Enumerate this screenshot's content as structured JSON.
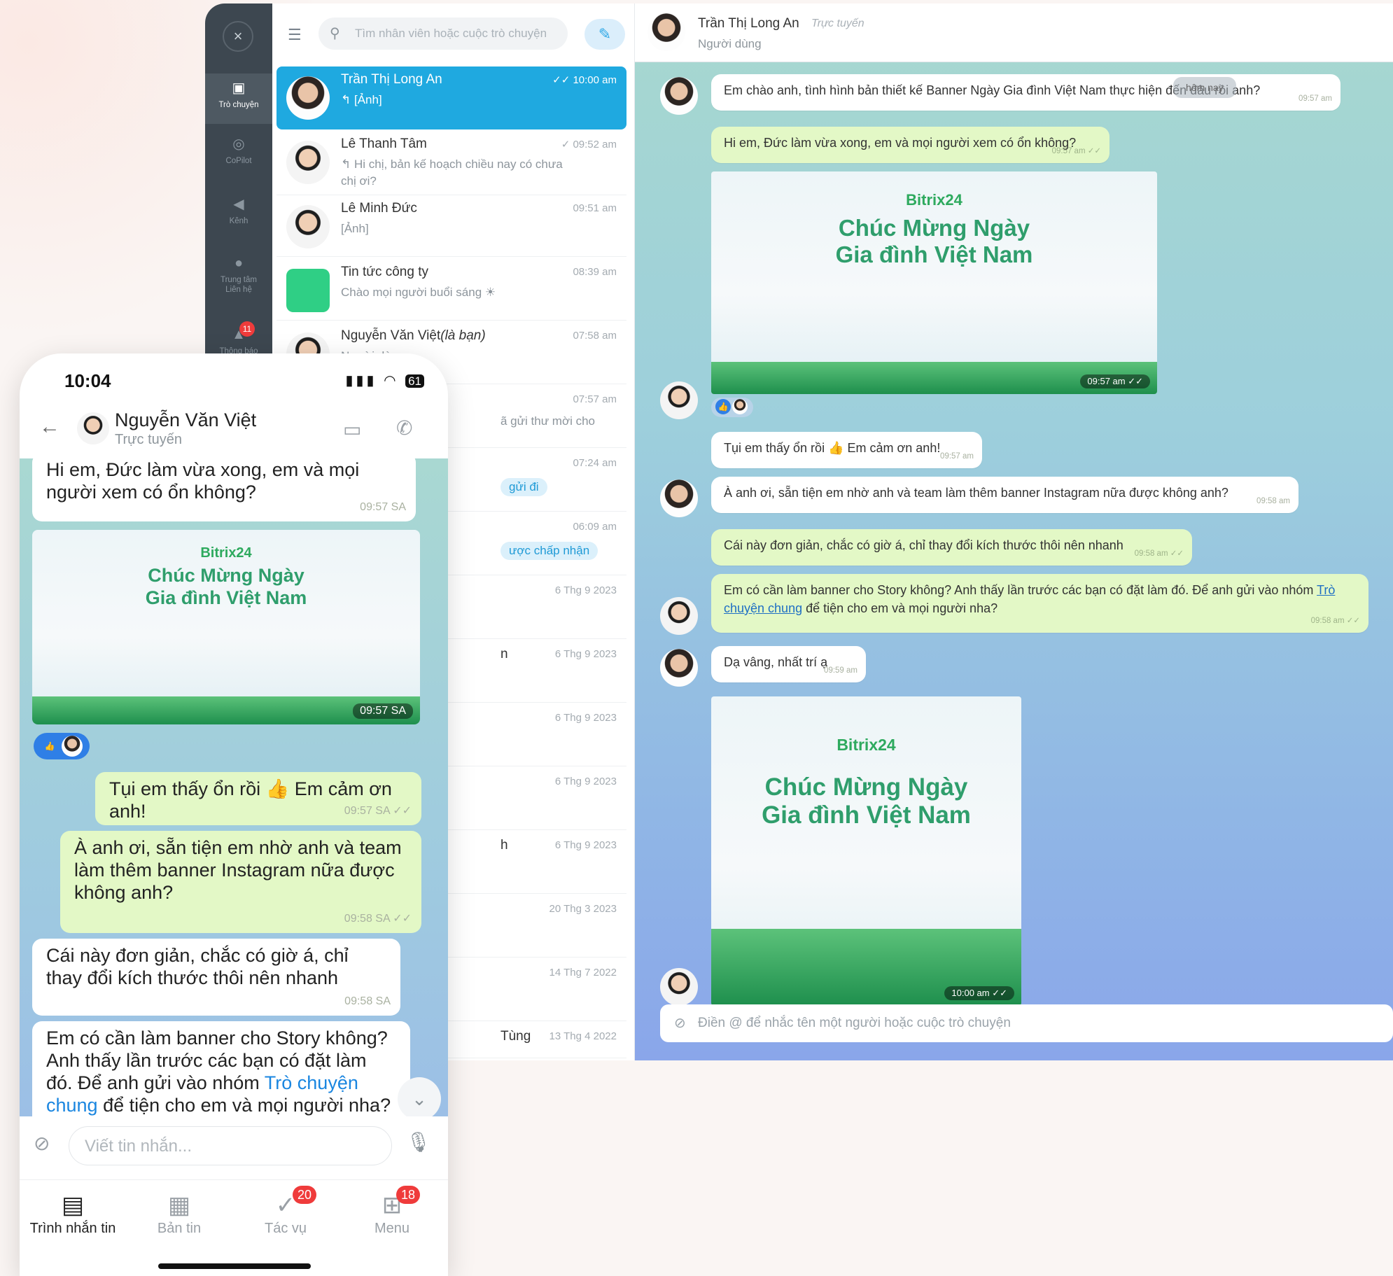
{
  "desktop": {
    "rail": {
      "close": "×",
      "items": [
        {
          "label": "Trò chuyện"
        },
        {
          "label": "CoPilot"
        },
        {
          "label": "Kênh"
        },
        {
          "label": "Trung tâm Liên hệ"
        },
        {
          "label": "Thông báo"
        }
      ],
      "notif_badge": "11"
    },
    "chatlist": {
      "search_placeholder": "Tìm nhân viên hoặc cuộc trò chuyện",
      "items": [
        {
          "name": "Trần Thị Long An",
          "preview": "↰ [Ảnh]",
          "time": "✓✓ 10:00 am"
        },
        {
          "name": "Lê Thanh Tâm",
          "preview": "↰ Hi chị, bản kế hoạch chiều nay có chưa chị ơi?",
          "time": "✓ 09:52 am"
        },
        {
          "name": "Lê Minh Đức",
          "preview": "[Ảnh]",
          "time": "09:51 am"
        },
        {
          "name": "Tin tức công ty",
          "preview": "Chào mọi người buổi sáng ☀",
          "time": "08:39 am"
        },
        {
          "name": "Nguyễn Văn Việt",
          "name_suffix": "(là bạn)",
          "preview": "Người dùng",
          "time": "07:58 am"
        },
        {
          "name": "",
          "preview": "ã gửi thư mời cho",
          "time": "07:57 am"
        },
        {
          "name": "",
          "preview": "",
          "time": "07:24 am",
          "pill": "gửi đi"
        },
        {
          "name": "",
          "preview": "",
          "time": "06:09 am",
          "pill": "ược chấp nhận"
        },
        {
          "name": "",
          "preview": "",
          "time": "6 Thg 9 2023"
        },
        {
          "name": "n",
          "preview": "",
          "time": "6 Thg 9 2023"
        },
        {
          "name": "",
          "preview": "",
          "time": "6 Thg 9 2023"
        },
        {
          "name": "",
          "preview": "",
          "time": "6 Thg 9 2023"
        },
        {
          "name": "h",
          "preview": "",
          "time": "6 Thg 9 2023"
        },
        {
          "name": "",
          "preview": "",
          "time": "20 Thg 3 2023"
        },
        {
          "name": "",
          "preview": "",
          "time": "14 Thg 7 2022"
        },
        {
          "name": "Tùng",
          "preview": "",
          "time": "13 Thg 4 2022"
        }
      ]
    },
    "conversation": {
      "name": "Trần Thị Long An",
      "status": "Trực tuyến",
      "role": "Người dùng",
      "date_divider": "hôm nay",
      "messages": [
        {
          "text": "Em chào anh, tình hình bản thiết kế Banner Ngày Gia đình Việt Nam thực hiện đến đâu rồi anh?",
          "time": "09:57 am"
        },
        {
          "text": "Hi em, Đức làm vừa xong, em và mọi người xem có ổn không?",
          "time": "09:57 am ✓✓"
        },
        {
          "text": "Tụi em thấy ổn rồi 👍 Em cảm ơn anh!",
          "time": "09:57 am"
        },
        {
          "text": "À anh ơi, sẵn tiện em nhờ anh và team làm thêm banner Instagram nữa được không anh?",
          "time": "09:58 am"
        },
        {
          "text": "Cái này đơn giản, chắc có giờ á, chỉ thay đổi kích thước thôi nên nhanh",
          "time": "09:58 am ✓✓"
        },
        {
          "text_a": "Em có cần làm banner cho Story không? Anh thấy lần trước các bạn có đặt làm đó. Để anh gửi vào nhóm ",
          "link": "Trò chuyện chung",
          "text_b": " để tiện cho em và mọi người nha?",
          "time": "09:58 am ✓✓"
        },
        {
          "text": "Dạ vâng, nhất trí ạ",
          "time": "09:59 am"
        }
      ],
      "banner1": {
        "brand": "Bitrix24",
        "line1": "Chúc Mừng Ngày",
        "line2": "Gia đình Việt Nam",
        "time": "09:57 am ✓✓"
      },
      "banner2": {
        "brand": "Bitrix24",
        "line1": "Chúc Mừng Ngày",
        "line2": "Gia đình Việt Nam",
        "time": "10:00 am ✓✓"
      },
      "input_placeholder": "Điền @ để nhắc tên một người hoặc cuộc trò chuyện"
    }
  },
  "phone": {
    "status_time": "10:04",
    "battery": "61",
    "contact_name": "Nguyễn Văn Việt",
    "contact_status": "Trực tuyến",
    "messages": [
      {
        "text": "Hi em, Đức làm vừa xong, em và mọi người xem có ổn không?",
        "time": "09:57 SA"
      },
      {
        "text": "Tụi em thấy ổn rồi 👍 Em cảm ơn anh!",
        "time": "09:57 SA ✓✓"
      },
      {
        "text": "À anh ơi, sẵn tiện em nhờ anh và team làm thêm banner Instagram nữa được không anh?",
        "time": "09:58 SA ✓✓"
      },
      {
        "text": "Cái này đơn giản, chắc có giờ á, chỉ thay đổi kích thước thôi nên nhanh",
        "time": "09:58 SA"
      },
      {
        "text_a": "Em có cần làm banner cho Story không? Anh thấy lần trước các bạn có đặt làm đó. Để anh gửi vào nhóm ",
        "link": "Trò chuyện chung",
        "text_b": " để tiện cho em và mọi người nha?"
      }
    ],
    "banner": {
      "brand": "Bitrix24",
      "line1": "Chúc Mừng Ngày",
      "line2": "Gia đình Việt Nam",
      "time": "09:57 SA"
    },
    "input_placeholder": "Viết tin nhắn...",
    "tabs": [
      {
        "label": "Trình nhắn tin"
      },
      {
        "label": "Bản tin"
      },
      {
        "label": "Tác vụ",
        "badge": "20"
      },
      {
        "label": "Menu",
        "badge": "18"
      }
    ]
  }
}
